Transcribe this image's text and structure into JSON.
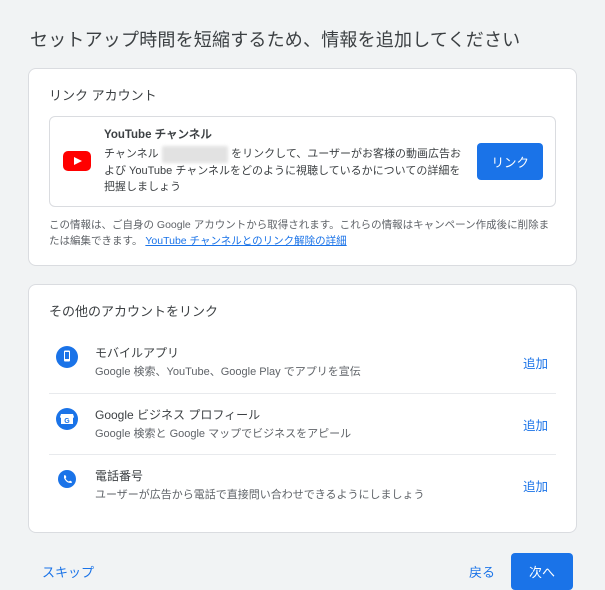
{
  "page": {
    "title": "セットアップ時間を短縮するため、情報を追加してください"
  },
  "linkCard": {
    "title": "リンク アカウント",
    "youtube": {
      "heading": "YouTube チャンネル",
      "desc_pre": "チャンネル ",
      "channel_name": "████████",
      "desc_post": " をリンクして、ユーザーがお客様の動画広告および YouTube チャンネルをどのように視聴しているかについての詳細を把握しましょう",
      "button": "リンク"
    },
    "disclaimer_text": "この情報は、ご自身の Google アカウントから取得されます。これらの情報はキャンペーン作成後に削除または編集できます。 ",
    "disclaimer_link": "YouTube チャンネルとのリンク解除の詳細"
  },
  "otherCard": {
    "title": "その他のアカウントをリンク",
    "add_label": "追加",
    "rows": [
      {
        "heading": "モバイルアプリ",
        "sub": "Google 検索、YouTube、Google Play でアプリを宣伝"
      },
      {
        "heading": "Google ビジネス プロフィール",
        "sub": "Google 検索と Google マップでビジネスをアピール"
      },
      {
        "heading": "電話番号",
        "sub": "ユーザーが広告から電話で直接問い合わせできるようにしましょう"
      }
    ]
  },
  "footer": {
    "skip": "スキップ",
    "back": "戻る",
    "next": "次へ"
  }
}
